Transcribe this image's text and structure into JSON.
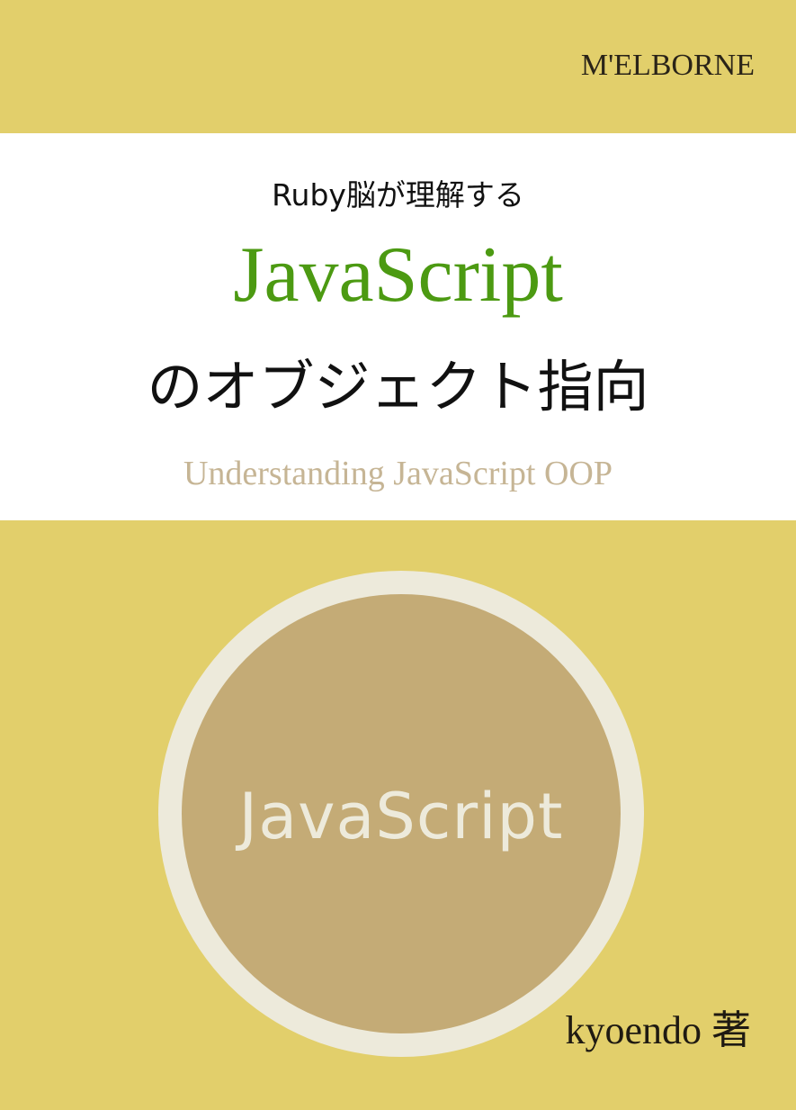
{
  "cover": {
    "publisher": "M'ELBORNE",
    "subtitle_pre": "Ruby脳が理解する",
    "title_main": "JavaScript",
    "title_post": "のオブジェクト指向",
    "title_en": "Understanding JavaScript OOP",
    "badge_text": "JavaScript",
    "author": "kyoendo 著"
  },
  "colors": {
    "background": "#e2cf6b",
    "title_green": "#4c9a12",
    "english_title": "#c6b595",
    "badge_ring": "#edeadb",
    "badge_fill": "#c4ab76"
  }
}
